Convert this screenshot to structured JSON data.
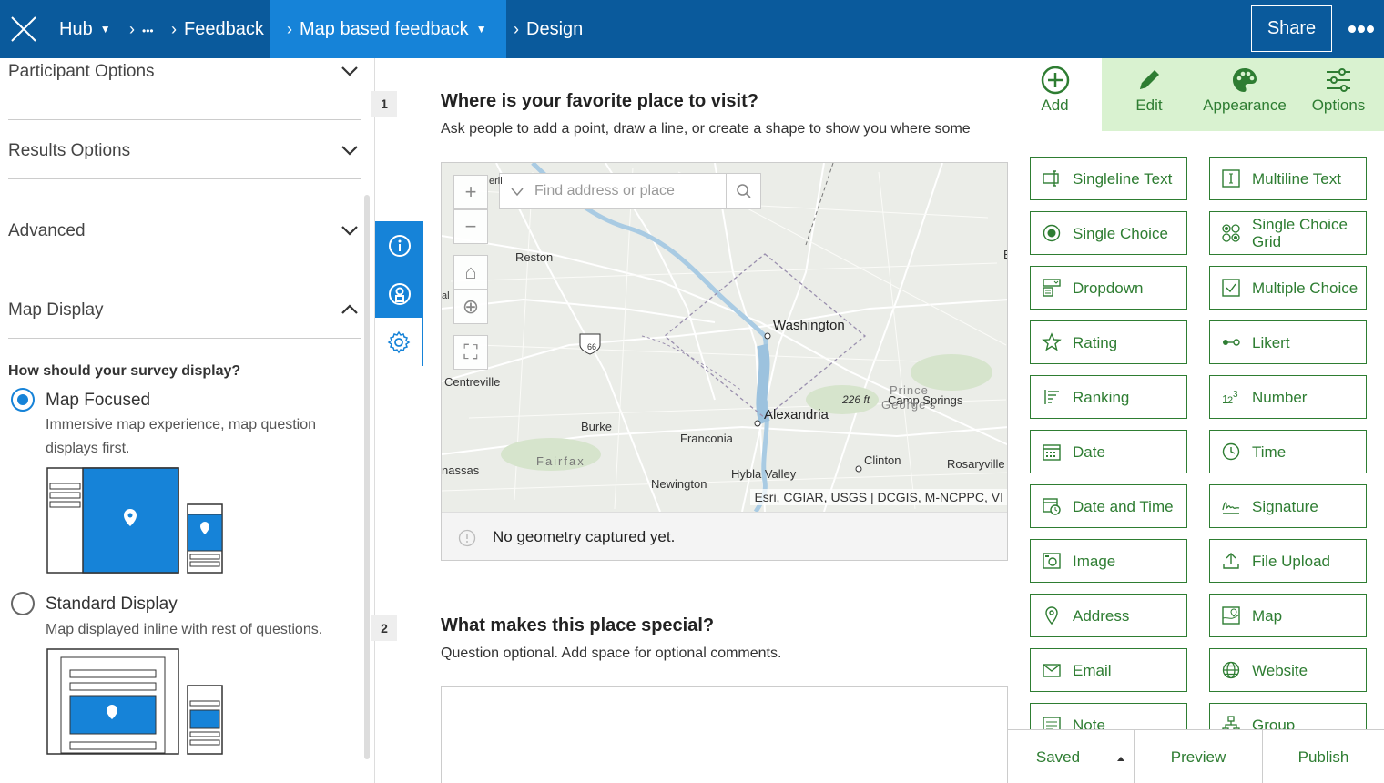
{
  "topbar": {
    "breadcrumbs": [
      {
        "label": "Hub",
        "has_caret": true
      },
      {
        "label": "•••"
      },
      {
        "label": "Feedback"
      },
      {
        "label": "Map based feedback",
        "active": true,
        "has_caret": true
      },
      {
        "label": "Design"
      }
    ],
    "share_label": "Share"
  },
  "left_panel": {
    "sections": [
      {
        "label": "Participant Options",
        "expanded": false
      },
      {
        "label": "Results Options",
        "expanded": false
      },
      {
        "label": "Advanced",
        "expanded": false
      },
      {
        "label": "Map Display",
        "expanded": true
      }
    ],
    "question": "How should your survey display?",
    "options": [
      {
        "title": "Map Focused",
        "desc1": "Immersive map experience, map question",
        "desc2": "displays first.",
        "selected": true
      },
      {
        "title": "Standard Display",
        "desc1": "Map displayed inline with rest of questions.",
        "selected": false
      }
    ]
  },
  "canvas": {
    "questions": [
      {
        "number": "1",
        "title": "Where is your favorite place to visit?",
        "desc": "Ask people to add a point, draw a line, or create a shape to show you where some"
      },
      {
        "number": "2",
        "title": "What makes this place special?",
        "desc": "Question optional. Add space for optional comments."
      }
    ],
    "map": {
      "search_placeholder": "Find address or place",
      "no_geometry": "No geometry captured yet.",
      "attribution": "Esri, CGIAR, USGS | DCGIS, M-NCPPC, VI",
      "labels": {
        "washington": "Washington",
        "alexandria": "Alexandria",
        "reston": "Reston",
        "centreville": "Centreville",
        "burke": "Burke",
        "franconia": "Franconia",
        "fairfax": "Fairfax",
        "newington": "Newington",
        "hybla": "Hybla Valley",
        "clinton": "Clinton",
        "rosaryville": "Rosaryville",
        "camp_springs": "Camp Springs",
        "prince": "Prince",
        "george": "George's",
        "elev": "226 ft",
        "route": "66",
        "nassas": "nassas",
        "erli": "erli",
        "al": "al",
        "e": "E"
      }
    }
  },
  "right_panel": {
    "tabs": [
      {
        "label": "Add",
        "icon": "plus-circle-icon"
      },
      {
        "label": "Edit",
        "icon": "pencil-icon"
      },
      {
        "label": "Appearance",
        "icon": "palette-icon"
      },
      {
        "label": "Options",
        "icon": "sliders-icon"
      }
    ],
    "tools_left": [
      "Singleline Text",
      "Single Choice",
      "Dropdown",
      "Rating",
      "Ranking",
      "Date",
      "Date and Time",
      "Image",
      "Address",
      "Email",
      "Note"
    ],
    "tools_right": [
      "Multiline Text",
      "Single Choice Grid",
      "Multiple Choice",
      "Likert",
      "Number",
      "Time",
      "Signature",
      "File Upload",
      "Map",
      "Website",
      "Group"
    ],
    "bottom": {
      "saved": "Saved",
      "preview": "Preview",
      "publish": "Publish"
    }
  },
  "colors": {
    "topbar": "#0a5a9c",
    "accent_blue": "#1683d8",
    "accent_green": "#2e7d32",
    "active_tab": "#d9f2d0"
  }
}
